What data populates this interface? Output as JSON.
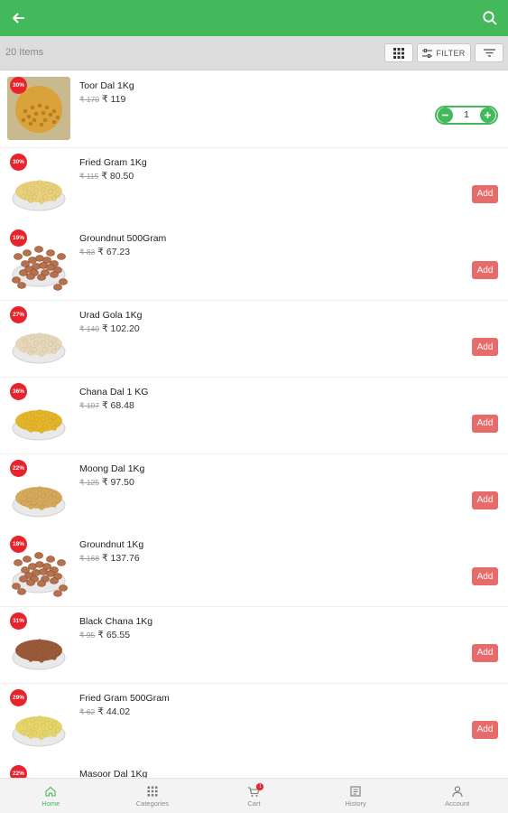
{
  "appbar": {
    "back_icon": "arrow-left-icon",
    "search_icon": "search-icon",
    "color": "#43b95b"
  },
  "toolbar": {
    "item_count": "20 Items",
    "filter_label": "FILTER"
  },
  "products": [
    {
      "name": "Toor Dal 1Kg",
      "discount": "30%",
      "mrp": "₹ 170",
      "price": "₹ 119",
      "in_cart": true,
      "quantity": "1",
      "image": "toor-dal",
      "color": "#d9a23a"
    },
    {
      "name": "Fried Gram 1Kg",
      "discount": "30%",
      "mrp": "₹ 115",
      "price": "₹ 80.50",
      "in_cart": false,
      "add_label": "Add",
      "image": "fried-gram",
      "color": "#e8cf7a"
    },
    {
      "name": "Groundnut 500Gram",
      "discount": "19%",
      "mrp": "₹ 83",
      "price": "₹ 67.23",
      "in_cart": false,
      "add_label": "Add",
      "image": "groundnut",
      "color": "#b8714d"
    },
    {
      "name": "Urad Gola 1Kg",
      "discount": "27%",
      "mrp": "₹ 140",
      "price": "₹ 102.20",
      "in_cart": false,
      "add_label": "Add",
      "image": "urad-gola",
      "color": "#e5d7b8"
    },
    {
      "name": "Chana Dal 1 KG",
      "discount": "36%",
      "mrp": "₹ 107",
      "price": "₹ 68.48",
      "in_cart": false,
      "add_label": "Add",
      "image": "chana-dal",
      "color": "#e4b42a"
    },
    {
      "name": "Moong Dal 1Kg",
      "discount": "22%",
      "mrp": "₹ 125",
      "price": "₹ 97.50",
      "in_cart": false,
      "add_label": "Add",
      "image": "moong-dal",
      "color": "#d5a85a"
    },
    {
      "name": "Groundnut 1Kg",
      "discount": "18%",
      "mrp": "₹ 168",
      "price": "₹ 137.76",
      "in_cart": false,
      "add_label": "Add",
      "image": "groundnut",
      "color": "#b8714d"
    },
    {
      "name": "Black Chana 1Kg",
      "discount": "31%",
      "mrp": "₹ 95",
      "price": "₹ 65.55",
      "in_cart": false,
      "add_label": "Add",
      "image": "black-chana",
      "color": "#9a5a3a"
    },
    {
      "name": "Fried Gram 500Gram",
      "discount": "29%",
      "mrp": "₹ 62",
      "price": "₹ 44.02",
      "in_cart": false,
      "add_label": "Add",
      "image": "fried-gram",
      "color": "#e5d46a"
    },
    {
      "name": "Masoor Dal 1Kg",
      "discount": "22%",
      "mrp": "",
      "price": "",
      "in_cart": false,
      "add_label": "",
      "image": "masoor-dal",
      "color": "#d4682a"
    }
  ],
  "bottom_nav": [
    {
      "label": "Home",
      "icon": "home-icon",
      "active": true
    },
    {
      "label": "Categories",
      "icon": "grid-icon",
      "active": false
    },
    {
      "label": "Cart",
      "icon": "cart-icon",
      "active": false,
      "badge": "1"
    },
    {
      "label": "History",
      "icon": "history-icon",
      "active": false
    },
    {
      "label": "Account",
      "icon": "user-icon",
      "active": false
    }
  ],
  "colors": {
    "brand": "#43b95b",
    "discount_badge": "#e8232b",
    "add_button": "#e86b6b"
  }
}
